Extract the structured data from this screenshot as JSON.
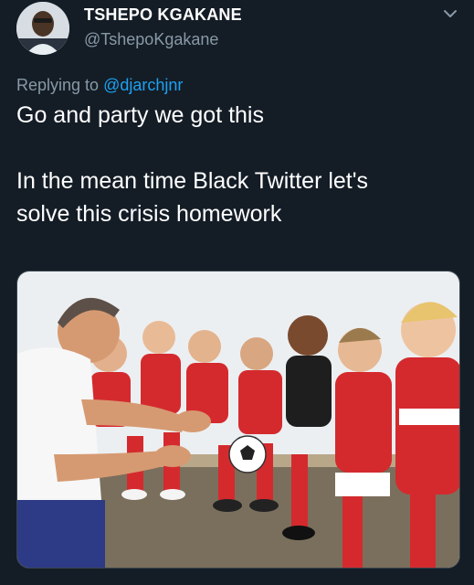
{
  "author": {
    "display_name": "TSHEPO KGAKANE",
    "handle": "@TshepoKgakane"
  },
  "reply": {
    "prefix": "Replying to",
    "mention": "@djarchjnr"
  },
  "tweet": {
    "line1": "Go and party we got this",
    "line2": "In the mean time Black Twitter let's",
    "line3": "solve this crisis homework"
  },
  "icons": {
    "menu": "chevron-down-icon"
  },
  "colors": {
    "background": "#141d26",
    "text": "#ffffff",
    "secondary": "#8899a6",
    "link": "#1da1f2",
    "jersey_red": "#d42a2e"
  }
}
